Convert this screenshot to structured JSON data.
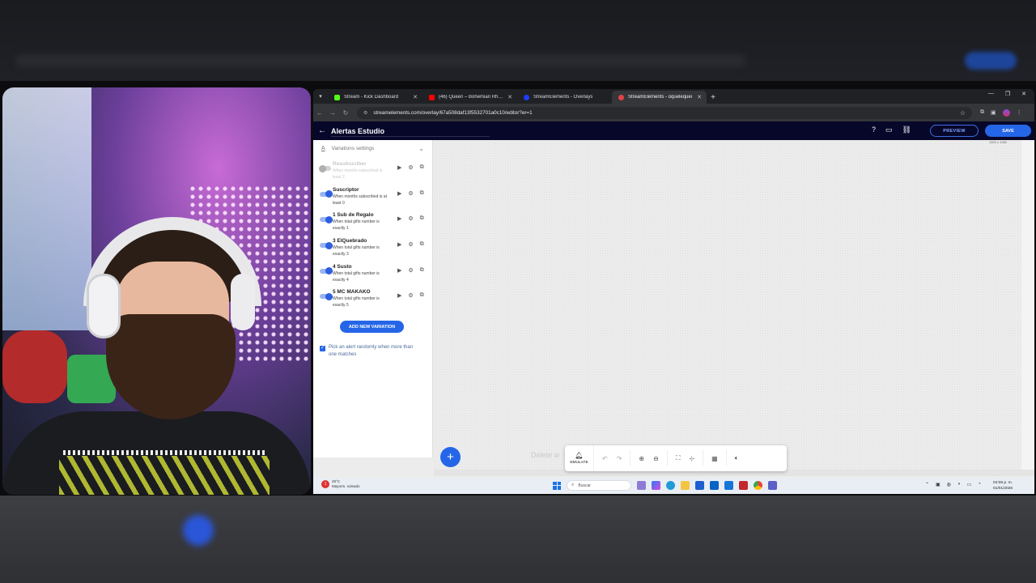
{
  "browser": {
    "tabs": [
      {
        "title": "Stream - Kick Dashboard",
        "color": "#53fc18",
        "active": false
      },
      {
        "title": "(46) Queen – Bohemian Rhapso",
        "color": "#ff0000",
        "active": false
      },
      {
        "title": "StreamElements - Overlays",
        "color": "#1e3cff",
        "active": false
      },
      {
        "title": "StreamElements - oquelequei",
        "color": "#e04444",
        "active": true
      }
    ],
    "new_tab": "+",
    "url": "streamelements.com/overlay/67a508daf13f5532701a0c10/editor?er=1"
  },
  "app": {
    "title": "Alertas Estudio",
    "preview_label": "PREVIEW",
    "save_label": "SAVE",
    "panel_header": "Variations settings",
    "variations": [
      {
        "name": "Resubscriber",
        "desc": "When months subscribed is least 2",
        "enabled": false
      },
      {
        "name": "Suscriptor",
        "desc": "When months subscribed is at least 0",
        "enabled": true
      },
      {
        "name": "1 Sub de Regalo",
        "desc": "When total gifts number is exactly 1",
        "enabled": true
      },
      {
        "name": "3 ElQuebrado",
        "desc": "When total gifts number is exactly 3",
        "enabled": true
      },
      {
        "name": "4 Susto",
        "desc": "When total gifts number is exactly 4",
        "enabled": true
      },
      {
        "name": "5 MC MAKAKO",
        "desc": "When total gifts number is exactly 5",
        "enabled": true
      }
    ],
    "add_variation_label": "ADD NEW VARIATION",
    "random_pick_label": "Pick an alert randomly when more than one matches",
    "random_pick_checked": true,
    "canvas_resolution": "1920 x 1080",
    "delete_hint": "Delete w",
    "emulate_label": "EMULATE"
  },
  "taskbar": {
    "weather_temp": "28°C",
    "weather_desc": "Mayorm. soleado",
    "weather_badge": "1",
    "search_placeholder": "Buscar",
    "time": "04:08 p. m.",
    "date": "01/01/2026"
  }
}
